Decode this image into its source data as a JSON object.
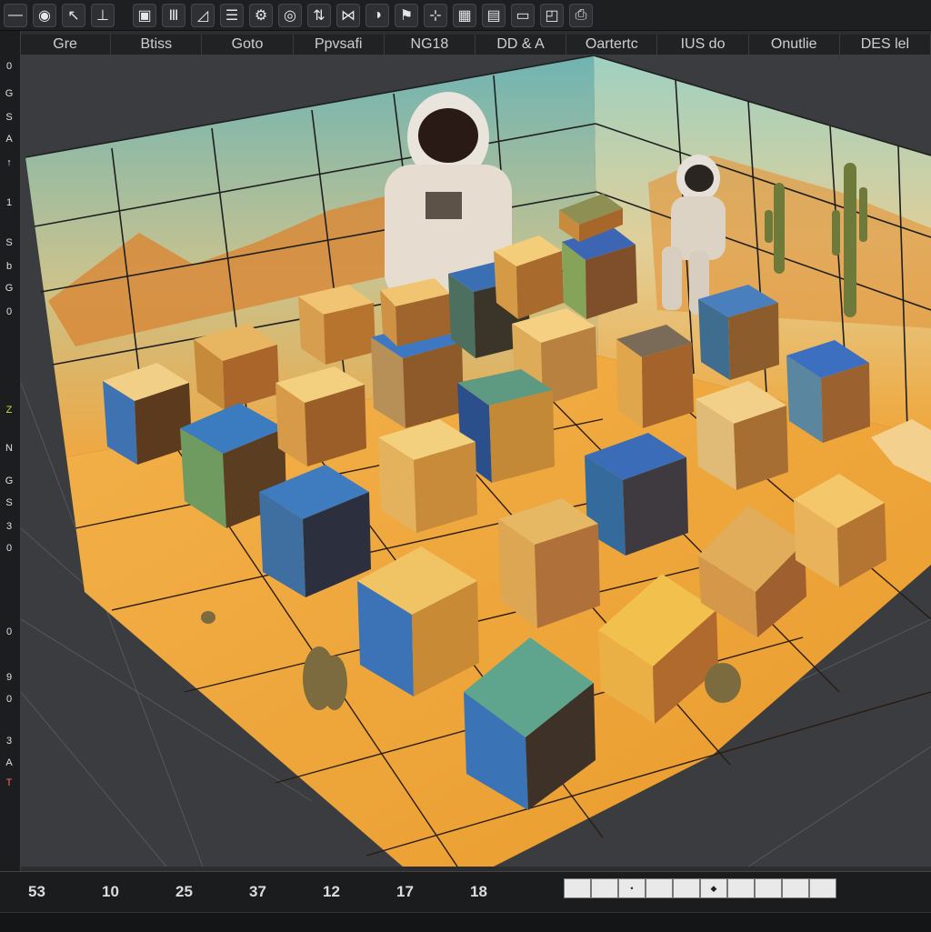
{
  "toolbar": {
    "icons": [
      "minus-icon",
      "shield-icon",
      "arrow-icon",
      "axis-icon",
      "clipboard-icon",
      "grid-icon",
      "pen-icon",
      "lines-icon",
      "gear-icon",
      "target-icon",
      "transform-icon",
      "bowtie-icon",
      "sound-icon",
      "flag-icon",
      "scale-icon",
      "calendar-icon",
      "image-icon",
      "window-icon",
      "frame-icon",
      "save-icon"
    ]
  },
  "menu": {
    "items": [
      "Gre",
      "Btiss",
      "Goto",
      "Ppvsafi",
      "NG18",
      "DD & A",
      "Oartertc",
      "IUS do",
      "Onutlie",
      "DES lel"
    ]
  },
  "left_panel": {
    "labels": [
      "0",
      "G",
      "S",
      "A",
      "↑",
      "1",
      "S",
      "b",
      "G",
      "0",
      "Z",
      "N",
      "G",
      "S",
      "3",
      "0",
      "0",
      "9",
      "0",
      "3",
      "A",
      "T"
    ]
  },
  "timeline": {
    "numbers": [
      "53",
      "10",
      "25",
      "37",
      "12",
      "17",
      "18"
    ],
    "frame_cells": [
      "",
      "",
      "•",
      "",
      "",
      "◆",
      "",
      "",
      "",
      ""
    ]
  },
  "colors": {
    "sand": "#f2a63a",
    "sky": "#8fc4b3",
    "cube_blue": "#3f7bb8",
    "cube_tan": "#e4b560",
    "accent_green": "#b6e24a"
  }
}
